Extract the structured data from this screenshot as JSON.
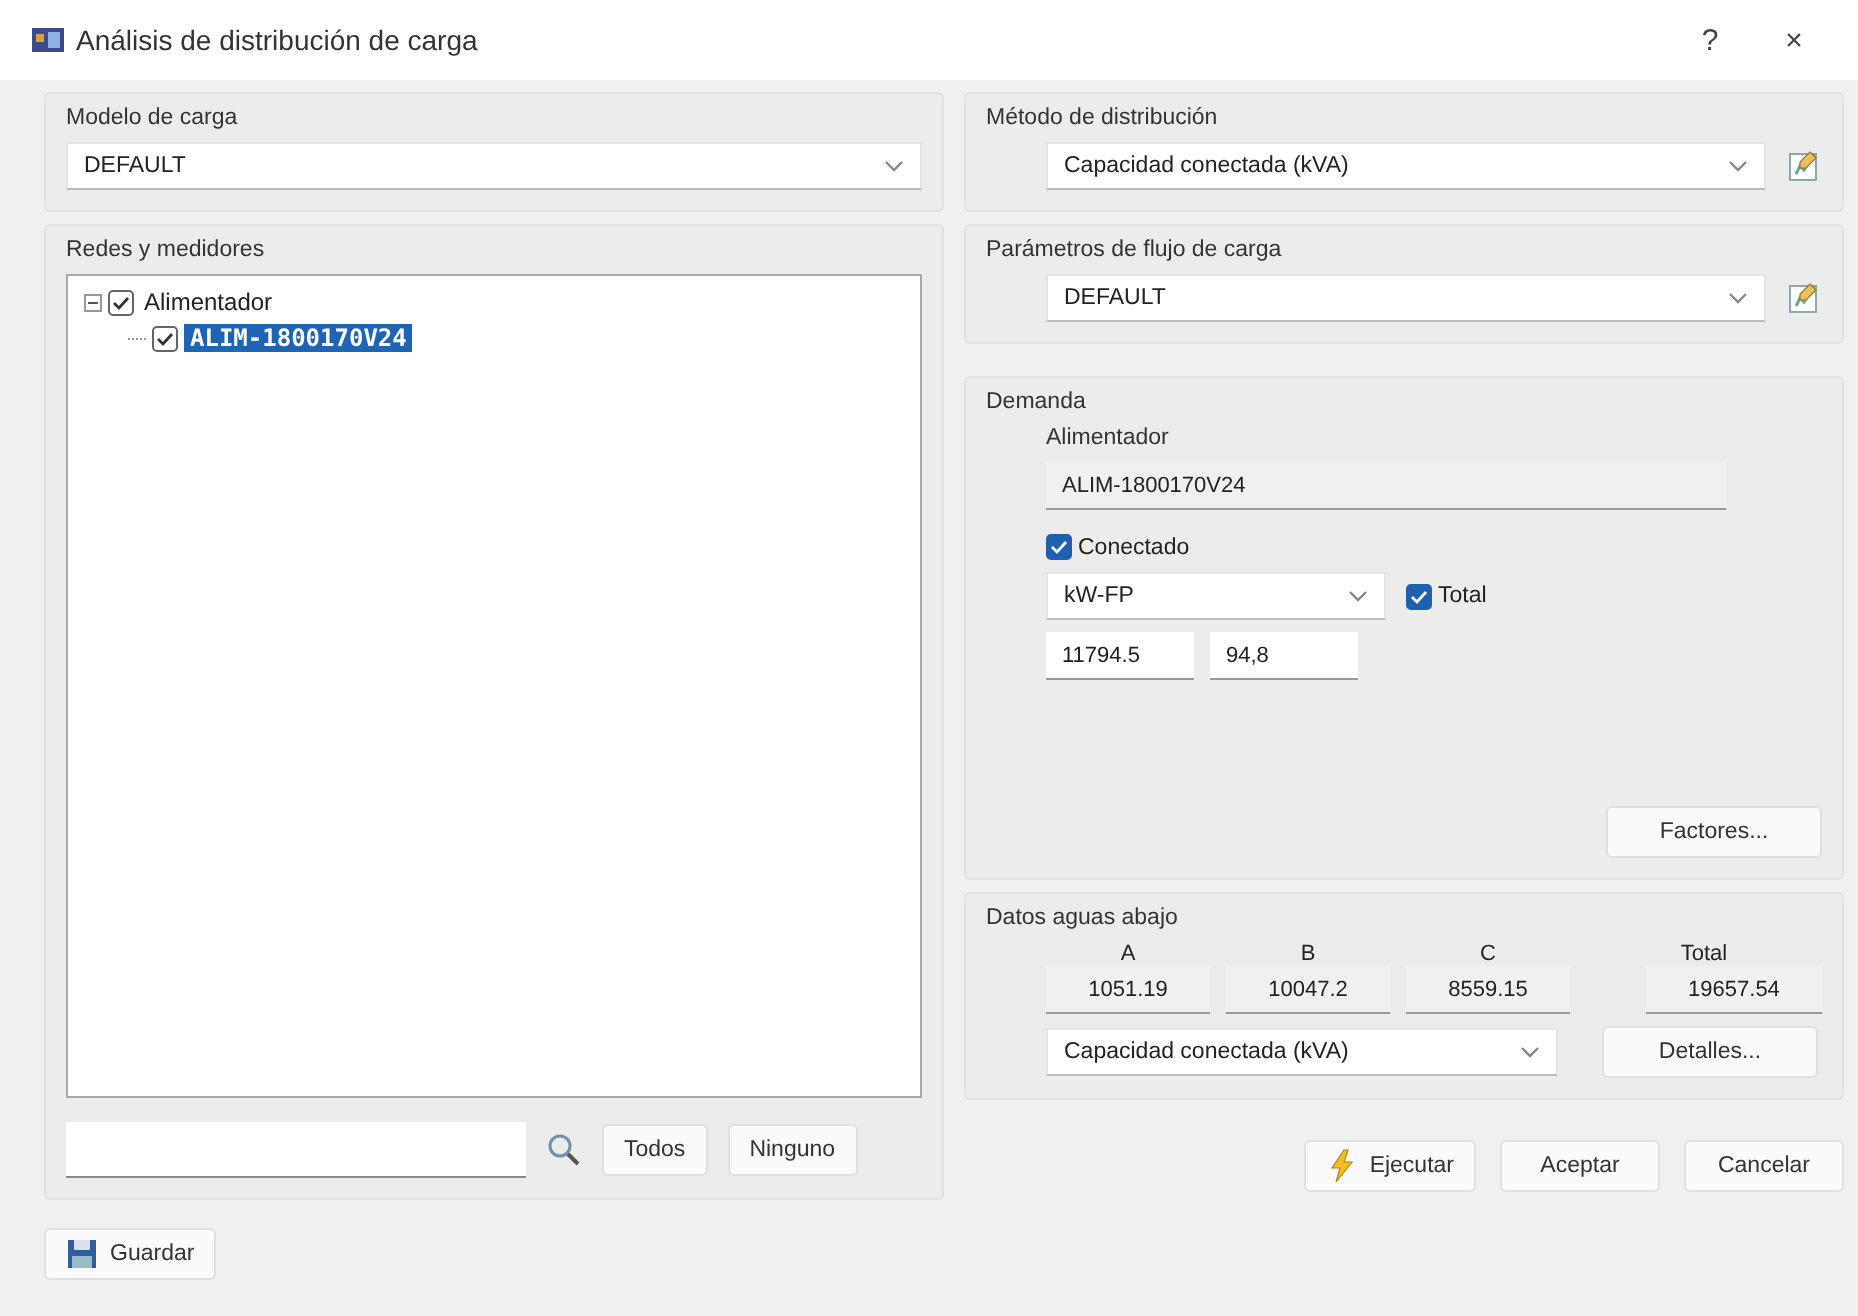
{
  "window": {
    "title": "Análisis de distribución de carga",
    "help": "?",
    "close": "×"
  },
  "load_model": {
    "label": "Modelo de carga",
    "value": "DEFAULT"
  },
  "networks": {
    "label": "Redes y medidores",
    "tree": [
      {
        "label": "Alimentador",
        "checked": true,
        "expanded": true,
        "selected": false,
        "children": [
          {
            "label": "ALIM-1800170V24",
            "checked": true,
            "selected": true
          }
        ]
      }
    ],
    "buttons": [
      "Todos",
      "Ninguno"
    ]
  },
  "method": {
    "label": "Método de distribución",
    "value": "Capacidad conectada (kVA)"
  },
  "flow_params": {
    "label": "Parámetros de flujo de carga",
    "value": "DEFAULT"
  },
  "demand": {
    "label": "Demanda",
    "feeder_label": "Alimentador",
    "feeder_value": "ALIM-1800170V24",
    "connected": {
      "label": "Conectado",
      "checked": true
    },
    "unit": "kW-FP",
    "total": {
      "label": "Total",
      "checked": true
    },
    "values": [
      "11794.5",
      "94,8"
    ],
    "factors_button": "Factores..."
  },
  "downstream": {
    "label": "Datos aguas abajo",
    "columns": [
      {
        "header": "A",
        "value": "1051.19"
      },
      {
        "header": "B",
        "value": "10047.2"
      },
      {
        "header": "C",
        "value": "8559.15"
      },
      {
        "header": "Total",
        "value": "19657.54"
      }
    ],
    "method": "Capacidad conectada (kVA)",
    "details_button": "Detalles..."
  },
  "footer": {
    "save": "Guardar",
    "run": "Ejecutar",
    "accept": "Aceptar",
    "cancel": "Cancelar"
  }
}
